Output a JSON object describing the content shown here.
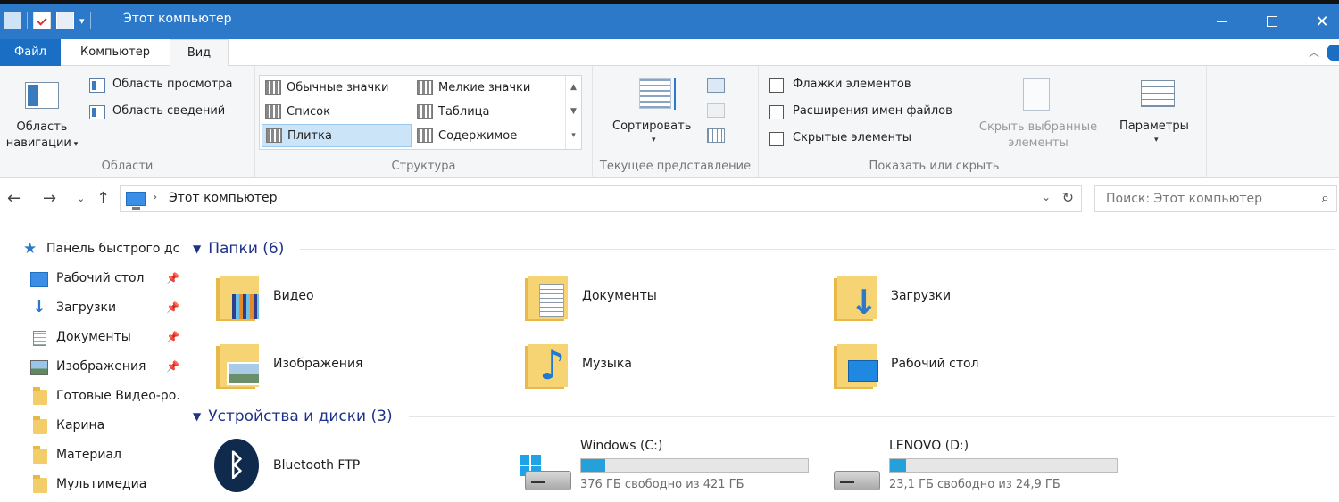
{
  "window": {
    "title": "Этот компьютер"
  },
  "ribbon_tabs": {
    "file": "Файл",
    "computer": "Компьютер",
    "view": "Вид"
  },
  "ribbon": {
    "areas": {
      "nav_pane_line1": "Область",
      "nav_pane_line2": "навигации",
      "preview_pane": "Область просмотра",
      "details_pane": "Область сведений",
      "label": "Области"
    },
    "layout": {
      "items": [
        "Обычные значки",
        "Мелкие значки",
        "Список",
        "Таблица",
        "Плитка",
        "Содержимое"
      ],
      "selected": "Плитка",
      "label": "Структура"
    },
    "current_view": {
      "sort": "Сортировать",
      "label": "Текущее представление"
    },
    "show_hide": {
      "item_checkboxes": "Флажки элементов",
      "file_extensions": "Расширения имен файлов",
      "hidden_items": "Скрытые элементы",
      "hide_selected_line1": "Скрыть выбранные",
      "hide_selected_line2": "элементы",
      "label": "Показать или скрыть"
    },
    "options": {
      "label": "Параметры"
    }
  },
  "address": {
    "path": "Этот компьютер"
  },
  "search": {
    "placeholder": "Поиск: Этот компьютер"
  },
  "sidebar": {
    "items": [
      {
        "label": "Панель быстрого дс",
        "icon": "star-icon",
        "pinned": false
      },
      {
        "label": "Рабочий стол",
        "icon": "desktop-icon",
        "pinned": true
      },
      {
        "label": "Загрузки",
        "icon": "download-icon",
        "pinned": true
      },
      {
        "label": "Документы",
        "icon": "document-icon",
        "pinned": true
      },
      {
        "label": "Изображения",
        "icon": "pictures-icon",
        "pinned": true
      },
      {
        "label": "Готовые Видео-ро.",
        "icon": "folder-icon",
        "pinned": false
      },
      {
        "label": "Карина",
        "icon": "folder-icon",
        "pinned": false
      },
      {
        "label": "Материал",
        "icon": "folder-icon",
        "pinned": false
      },
      {
        "label": "Мультимедиа",
        "icon": "folder-icon",
        "pinned": false
      }
    ]
  },
  "folders": {
    "header": "Папки (6)",
    "items": [
      {
        "label": "Видео",
        "icon": "video-folder-icon"
      },
      {
        "label": "Документы",
        "icon": "documents-folder-icon"
      },
      {
        "label": "Загрузки",
        "icon": "downloads-folder-icon"
      },
      {
        "label": "Изображения",
        "icon": "pictures-folder-icon"
      },
      {
        "label": "Музыка",
        "icon": "music-folder-icon"
      },
      {
        "label": "Рабочий стол",
        "icon": "desktop-folder-icon"
      }
    ]
  },
  "devices": {
    "header": "Устройства и диски (3)",
    "bluetooth": {
      "label": "Bluetooth FTP",
      "icon": "bluetooth-icon"
    },
    "drives": [
      {
        "label": "Windows (C:)",
        "free_text": "376 ГБ свободно из 421 ГБ",
        "used_fraction": 0.107,
        "icon": "windows-drive-icon"
      },
      {
        "label": "LENOVO (D:)",
        "free_text": "23,1 ГБ свободно из 24,9 ГБ",
        "used_fraction": 0.072,
        "icon": "hdd-icon"
      }
    ]
  },
  "colors": {
    "titlebar": "#2b79c8",
    "accent": "#1a6fc4",
    "group_header": "#1e3287",
    "drive_bar": "#26a0da"
  }
}
